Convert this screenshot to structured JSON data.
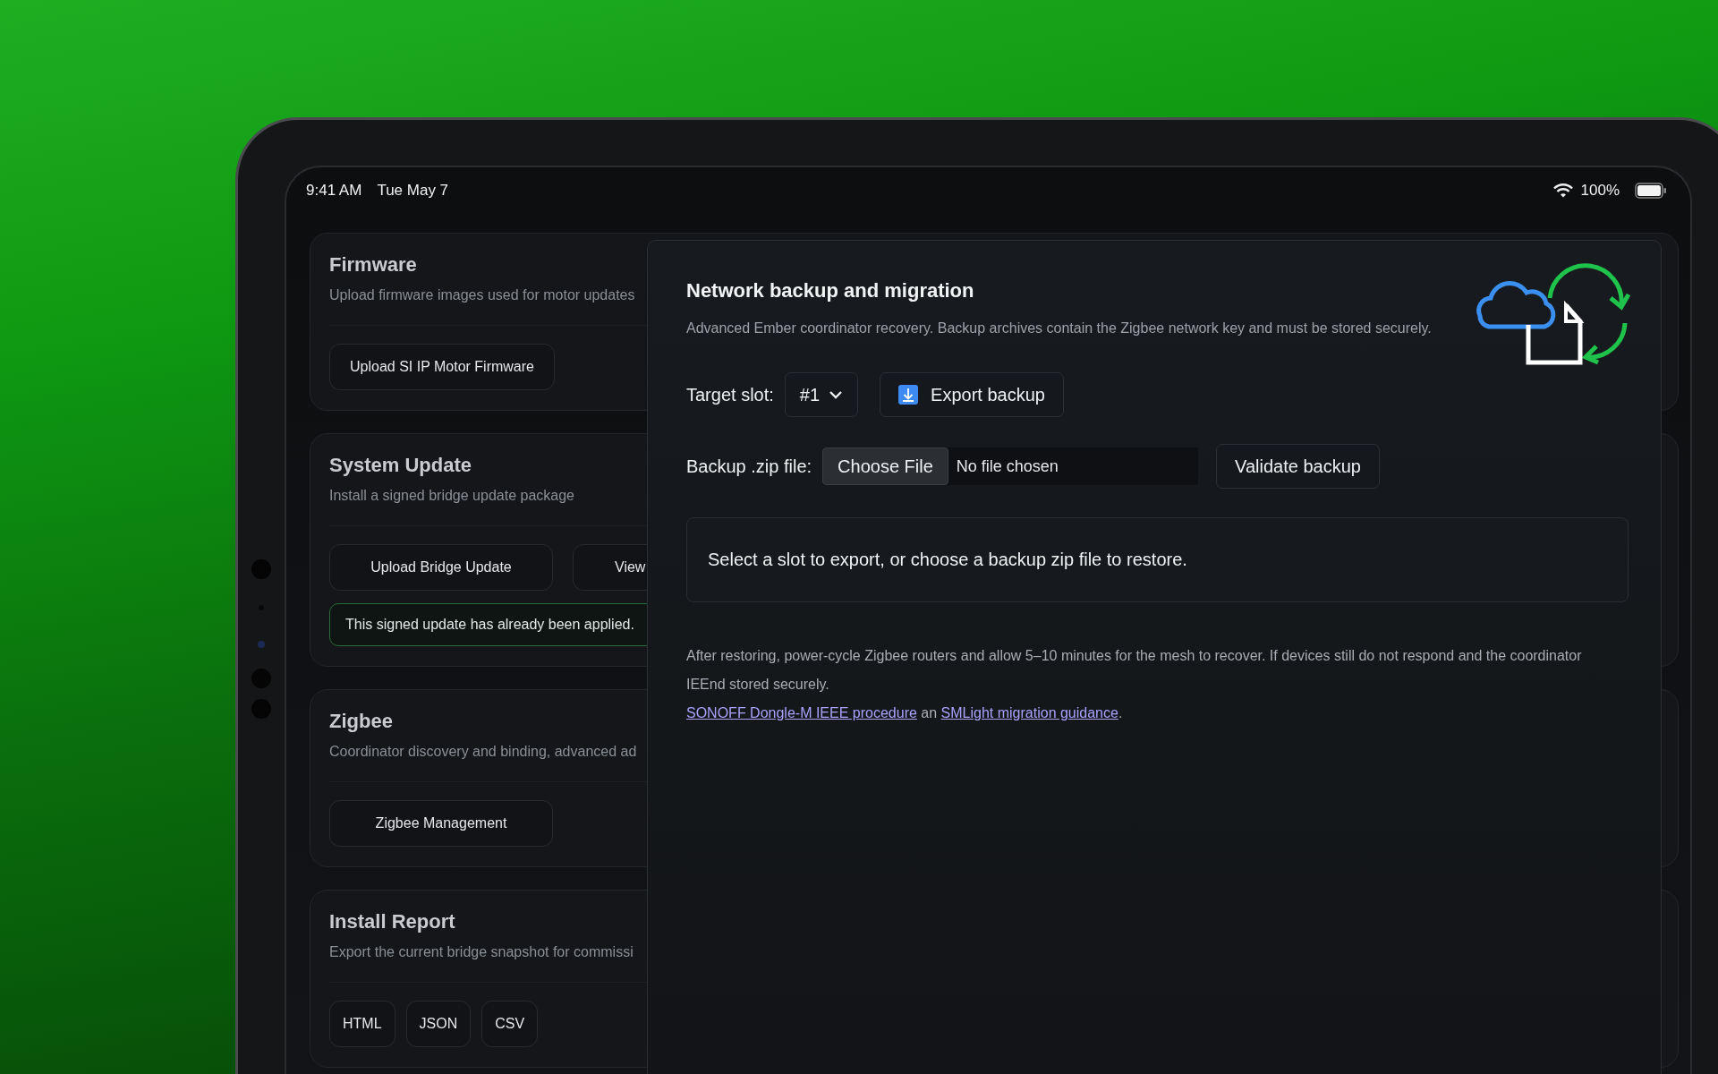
{
  "status_bar": {
    "time": "9:41 AM",
    "date": "Tue May 7",
    "battery": "100%"
  },
  "cards": [
    {
      "title": "Firmware",
      "description": "Upload firmware images used for motor updates",
      "buttons": [
        "Upload SI IP Motor Firmware"
      ]
    },
    {
      "title": "System Update",
      "description": "Install a signed bridge update package",
      "buttons": [
        "Upload Bridge Update",
        "View"
      ],
      "notice": "This signed update has already been applied."
    },
    {
      "title": "Zigbee",
      "description": "Coordinator discovery and binding, advanced ad",
      "buttons": [
        "Zigbee Management"
      ]
    },
    {
      "title": "Install Report",
      "description": "Export the current bridge snapshot for commissi",
      "buttons": [
        "HTML",
        "JSON",
        "CSV"
      ],
      "compact": true
    }
  ],
  "dialog": {
    "title": "Network backup and migration",
    "description": "Advanced Ember coordinator recovery. Backup archives contain the Zigbee network key and must be stored securely.",
    "target_slot_label": "Target slot:",
    "slot_value": "#1",
    "export_button": "Export backup",
    "file_label": "Backup .zip file:",
    "choose_file_button": "Choose File",
    "file_status": "No file chosen",
    "validate_button": "Validate backup",
    "info_message": "Select a slot to export, or choose a backup zip file to restore.",
    "note": "After restoring, power-cycle Zigbee routers and allow 5–10 minutes for the mesh to recover. If devices still do not respond and the coordinator IEEnd stored securely.",
    "links_line": [
      {
        "kind": "link",
        "text": "SONOFF Dongle-M IEEE procedure"
      },
      {
        "kind": "text",
        "text": "an"
      },
      {
        "kind": "link",
        "text": "SMLight migration guidance"
      },
      {
        "kind": "text",
        "text": "."
      }
    ]
  }
}
